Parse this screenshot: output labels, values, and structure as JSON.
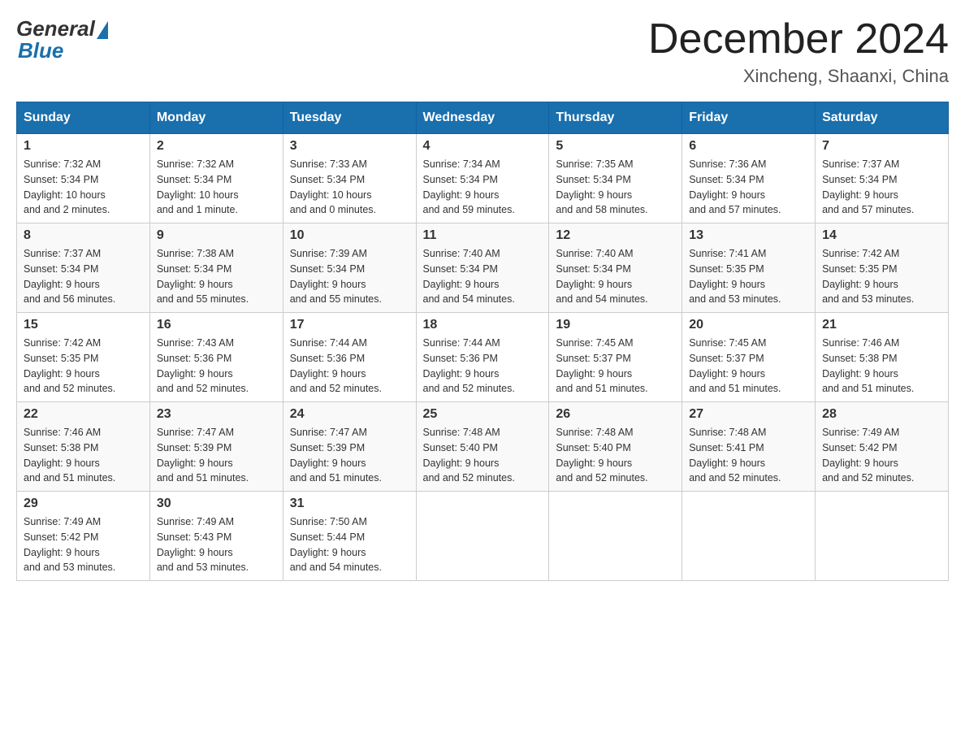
{
  "logo": {
    "general": "General",
    "blue": "Blue"
  },
  "title": {
    "month": "December 2024",
    "location": "Xincheng, Shaanxi, China"
  },
  "days_of_week": [
    "Sunday",
    "Monday",
    "Tuesday",
    "Wednesday",
    "Thursday",
    "Friday",
    "Saturday"
  ],
  "weeks": [
    [
      {
        "day": "1",
        "sunrise": "7:32 AM",
        "sunset": "5:34 PM",
        "daylight": "10 hours and 2 minutes."
      },
      {
        "day": "2",
        "sunrise": "7:32 AM",
        "sunset": "5:34 PM",
        "daylight": "10 hours and 1 minute."
      },
      {
        "day": "3",
        "sunrise": "7:33 AM",
        "sunset": "5:34 PM",
        "daylight": "10 hours and 0 minutes."
      },
      {
        "day": "4",
        "sunrise": "7:34 AM",
        "sunset": "5:34 PM",
        "daylight": "9 hours and 59 minutes."
      },
      {
        "day": "5",
        "sunrise": "7:35 AM",
        "sunset": "5:34 PM",
        "daylight": "9 hours and 58 minutes."
      },
      {
        "day": "6",
        "sunrise": "7:36 AM",
        "sunset": "5:34 PM",
        "daylight": "9 hours and 57 minutes."
      },
      {
        "day": "7",
        "sunrise": "7:37 AM",
        "sunset": "5:34 PM",
        "daylight": "9 hours and 57 minutes."
      }
    ],
    [
      {
        "day": "8",
        "sunrise": "7:37 AM",
        "sunset": "5:34 PM",
        "daylight": "9 hours and 56 minutes."
      },
      {
        "day": "9",
        "sunrise": "7:38 AM",
        "sunset": "5:34 PM",
        "daylight": "9 hours and 55 minutes."
      },
      {
        "day": "10",
        "sunrise": "7:39 AM",
        "sunset": "5:34 PM",
        "daylight": "9 hours and 55 minutes."
      },
      {
        "day": "11",
        "sunrise": "7:40 AM",
        "sunset": "5:34 PM",
        "daylight": "9 hours and 54 minutes."
      },
      {
        "day": "12",
        "sunrise": "7:40 AM",
        "sunset": "5:34 PM",
        "daylight": "9 hours and 54 minutes."
      },
      {
        "day": "13",
        "sunrise": "7:41 AM",
        "sunset": "5:35 PM",
        "daylight": "9 hours and 53 minutes."
      },
      {
        "day": "14",
        "sunrise": "7:42 AM",
        "sunset": "5:35 PM",
        "daylight": "9 hours and 53 minutes."
      }
    ],
    [
      {
        "day": "15",
        "sunrise": "7:42 AM",
        "sunset": "5:35 PM",
        "daylight": "9 hours and 52 minutes."
      },
      {
        "day": "16",
        "sunrise": "7:43 AM",
        "sunset": "5:36 PM",
        "daylight": "9 hours and 52 minutes."
      },
      {
        "day": "17",
        "sunrise": "7:44 AM",
        "sunset": "5:36 PM",
        "daylight": "9 hours and 52 minutes."
      },
      {
        "day": "18",
        "sunrise": "7:44 AM",
        "sunset": "5:36 PM",
        "daylight": "9 hours and 52 minutes."
      },
      {
        "day": "19",
        "sunrise": "7:45 AM",
        "sunset": "5:37 PM",
        "daylight": "9 hours and 51 minutes."
      },
      {
        "day": "20",
        "sunrise": "7:45 AM",
        "sunset": "5:37 PM",
        "daylight": "9 hours and 51 minutes."
      },
      {
        "day": "21",
        "sunrise": "7:46 AM",
        "sunset": "5:38 PM",
        "daylight": "9 hours and 51 minutes."
      }
    ],
    [
      {
        "day": "22",
        "sunrise": "7:46 AM",
        "sunset": "5:38 PM",
        "daylight": "9 hours and 51 minutes."
      },
      {
        "day": "23",
        "sunrise": "7:47 AM",
        "sunset": "5:39 PM",
        "daylight": "9 hours and 51 minutes."
      },
      {
        "day": "24",
        "sunrise": "7:47 AM",
        "sunset": "5:39 PM",
        "daylight": "9 hours and 51 minutes."
      },
      {
        "day": "25",
        "sunrise": "7:48 AM",
        "sunset": "5:40 PM",
        "daylight": "9 hours and 52 minutes."
      },
      {
        "day": "26",
        "sunrise": "7:48 AM",
        "sunset": "5:40 PM",
        "daylight": "9 hours and 52 minutes."
      },
      {
        "day": "27",
        "sunrise": "7:48 AM",
        "sunset": "5:41 PM",
        "daylight": "9 hours and 52 minutes."
      },
      {
        "day": "28",
        "sunrise": "7:49 AM",
        "sunset": "5:42 PM",
        "daylight": "9 hours and 52 minutes."
      }
    ],
    [
      {
        "day": "29",
        "sunrise": "7:49 AM",
        "sunset": "5:42 PM",
        "daylight": "9 hours and 53 minutes."
      },
      {
        "day": "30",
        "sunrise": "7:49 AM",
        "sunset": "5:43 PM",
        "daylight": "9 hours and 53 minutes."
      },
      {
        "day": "31",
        "sunrise": "7:50 AM",
        "sunset": "5:44 PM",
        "daylight": "9 hours and 54 minutes."
      },
      null,
      null,
      null,
      null
    ]
  ],
  "labels": {
    "sunrise": "Sunrise:",
    "sunset": "Sunset:",
    "daylight": "Daylight:"
  }
}
